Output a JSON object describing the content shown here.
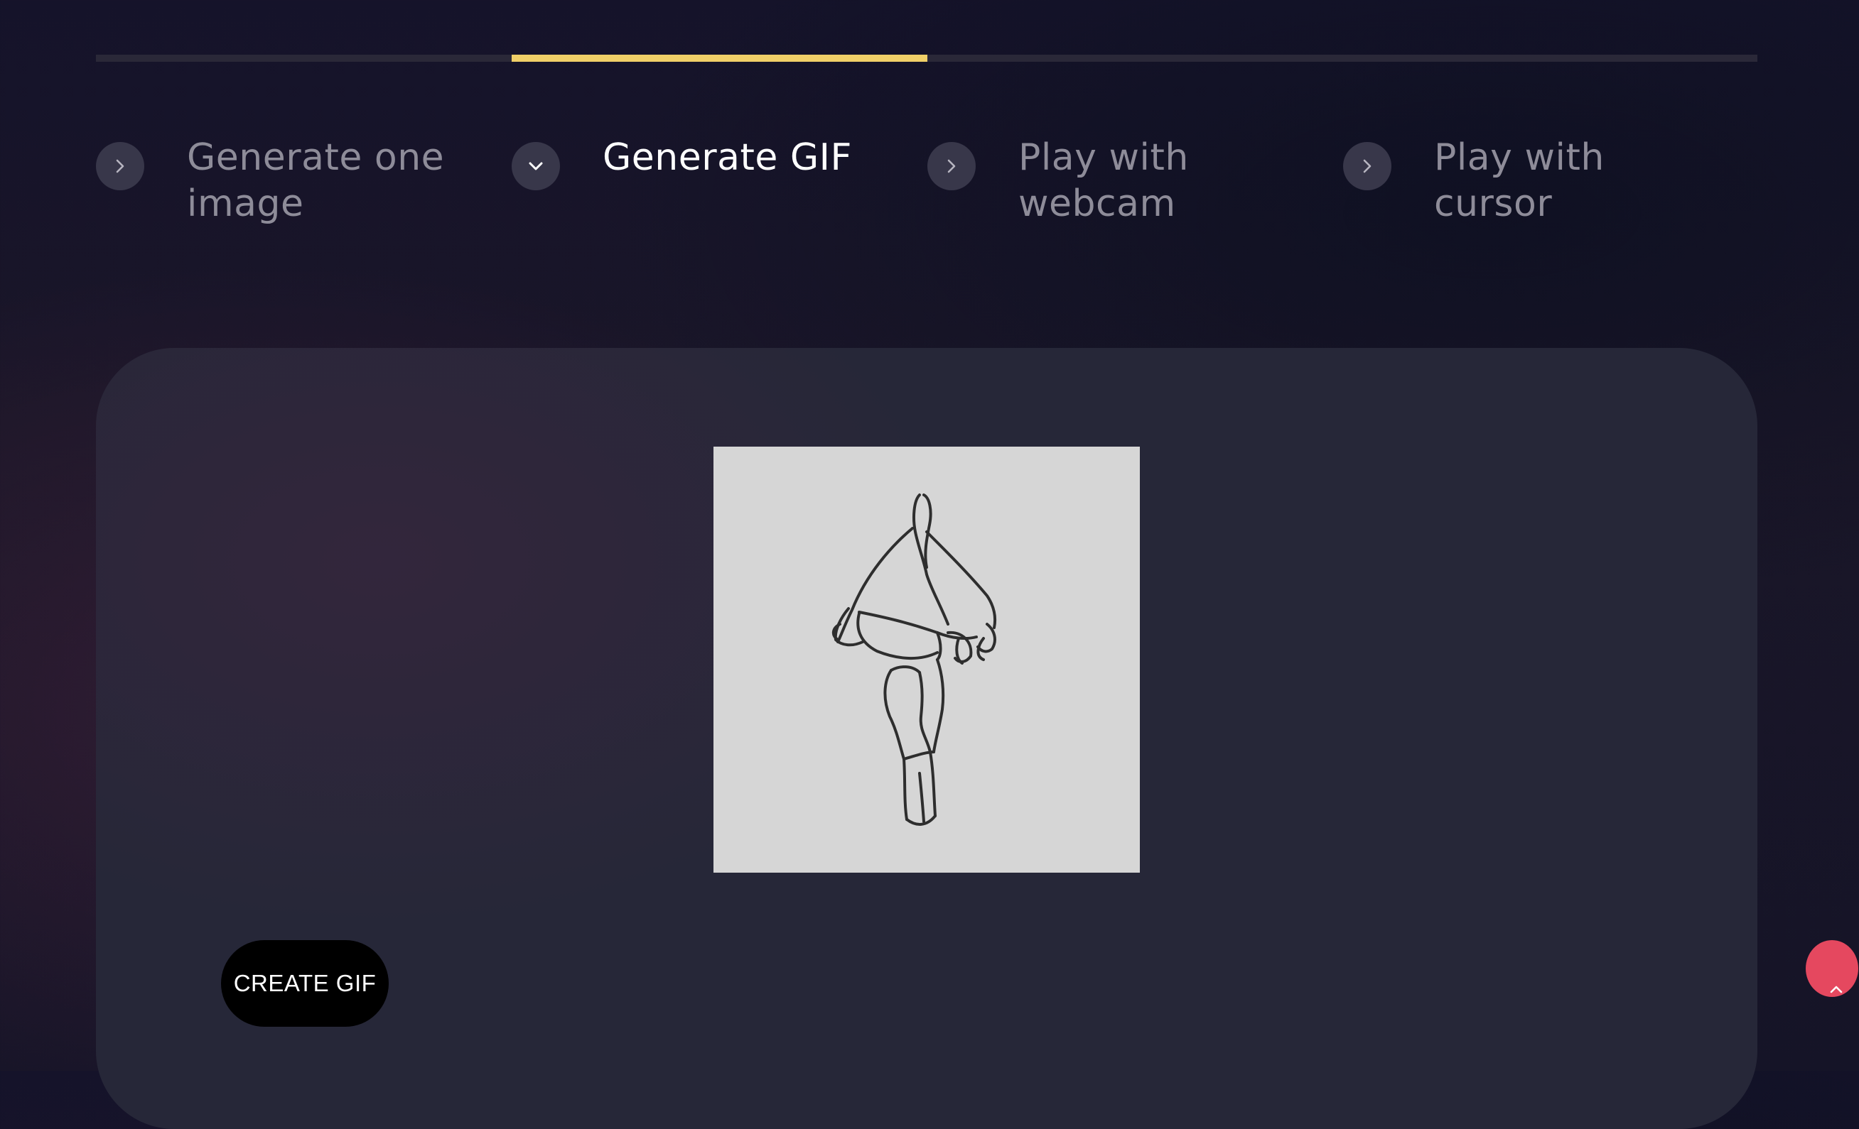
{
  "progress": {
    "total_steps": 4,
    "active_step": 2
  },
  "steps": [
    {
      "label": "Generate one image",
      "icon": "chevron-right-icon",
      "active": false
    },
    {
      "label": "Generate GIF",
      "icon": "chevron-down-icon",
      "active": true
    },
    {
      "label": "Play with webcam",
      "icon": "chevron-right-icon",
      "active": false
    },
    {
      "label": "Play with cursor",
      "icon": "chevron-right-icon",
      "active": false
    }
  ],
  "preview": {
    "content": "sketch-figure-image"
  },
  "actions": {
    "create_gif_label": "CREATE GIF"
  },
  "colors": {
    "accent": "#f0cf68",
    "badge": "#e5485f",
    "button_bg": "#000000"
  }
}
